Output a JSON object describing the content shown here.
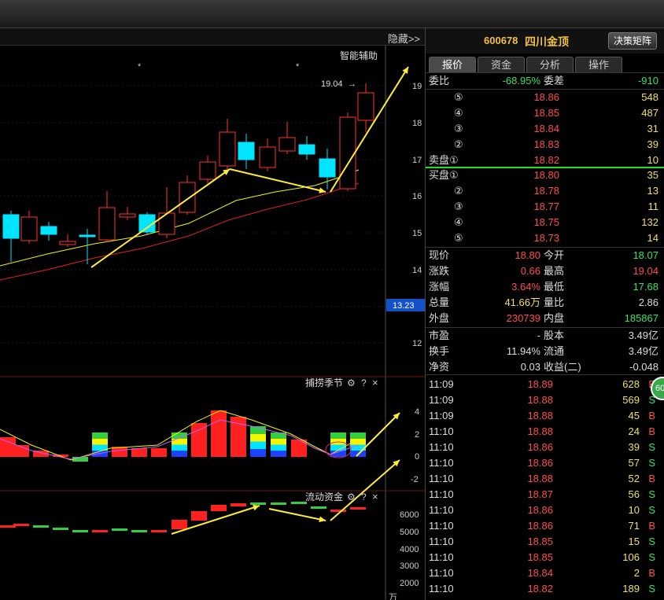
{
  "chart": {
    "hide_label": "隐藏>>",
    "assist_label": "智能辅助",
    "last_high_label": "19.04",
    "current_price_tag": "13.23",
    "price_axis": [
      "19",
      "18",
      "17",
      "16",
      "15",
      "14",
      "12"
    ],
    "indicator1": {
      "title": "捕捞季节",
      "axis": [
        "4",
        "2",
        "0",
        "-2"
      ]
    },
    "indicator2": {
      "title": "流动资金",
      "axis": [
        "6000",
        "5000",
        "4000",
        "3000",
        "2000"
      ],
      "unit": "万"
    },
    "gear_icon": "gear-icon",
    "help_label": "?",
    "close_label": "×",
    "star_label": "*"
  },
  "quote": {
    "code": "600678",
    "name": "四川金顶",
    "decision_button": "决策矩阵",
    "tabs": [
      "报价",
      "资金",
      "分析",
      "操作"
    ],
    "weibi": {
      "label": "委比",
      "value": "-68.95%",
      "label2": "委差",
      "value2": "-910"
    },
    "asks": [
      {
        "label": "⑤",
        "price": "18.86",
        "vol": "548"
      },
      {
        "label": "④",
        "price": "18.85",
        "vol": "487"
      },
      {
        "label": "③",
        "price": "18.84",
        "vol": "31"
      },
      {
        "label": "②",
        "price": "18.83",
        "vol": "39"
      },
      {
        "label": "卖盘①",
        "price": "18.82",
        "vol": "10"
      }
    ],
    "bids": [
      {
        "label": "买盘①",
        "price": "18.80",
        "vol": "35"
      },
      {
        "label": "②",
        "price": "18.78",
        "vol": "13"
      },
      {
        "label": "③",
        "price": "18.77",
        "vol": "11"
      },
      {
        "label": "④",
        "price": "18.75",
        "vol": "132"
      },
      {
        "label": "⑤",
        "price": "18.73",
        "vol": "14"
      }
    ],
    "stats": [
      {
        "l1": "现价",
        "v1": "18.80",
        "l2": "今开",
        "v2": "18.07"
      },
      {
        "l1": "涨跌",
        "v1": "0.66",
        "l2": "最高",
        "v2": "19.04"
      },
      {
        "l1": "涨幅",
        "v1": "3.64%",
        "l2": "最低",
        "v2": "17.68"
      },
      {
        "l1": "总量",
        "v1": "41.66万",
        "l2": "量比",
        "v2": "2.86"
      },
      {
        "l1": "外盘",
        "v1": "230739",
        "l2": "内盘",
        "v2": "185867"
      }
    ],
    "stats2": [
      {
        "l1": "市盈",
        "v1": "-",
        "l2": "股本",
        "v2": "3.49亿"
      },
      {
        "l1": "换手",
        "v1": "11.94%",
        "l2": "流通",
        "v2": "3.49亿"
      },
      {
        "l1": "净资",
        "v1": "0.03",
        "l2": "收益(二)",
        "v2": "-0.048"
      }
    ],
    "ticks": [
      {
        "time": "11:09",
        "price": "18.89",
        "vol": "628",
        "side": "B"
      },
      {
        "time": "11:09",
        "price": "18.88",
        "vol": "569",
        "side": "S"
      },
      {
        "time": "11:09",
        "price": "18.88",
        "vol": "45",
        "side": "B"
      },
      {
        "time": "11:10",
        "price": "18.88",
        "vol": "24",
        "side": "B"
      },
      {
        "time": "11:10",
        "price": "18.86",
        "vol": "39",
        "side": "S"
      },
      {
        "time": "11:10",
        "price": "18.86",
        "vol": "57",
        "side": "S"
      },
      {
        "time": "11:10",
        "price": "18.88",
        "vol": "52",
        "side": "B"
      },
      {
        "time": "11:10",
        "price": "18.87",
        "vol": "56",
        "side": "S"
      },
      {
        "time": "11:10",
        "price": "18.86",
        "vol": "10",
        "side": "S"
      },
      {
        "time": "11:10",
        "price": "18.86",
        "vol": "71",
        "side": "B"
      },
      {
        "time": "11:10",
        "price": "18.85",
        "vol": "15",
        "side": "S"
      },
      {
        "time": "11:10",
        "price": "18.85",
        "vol": "106",
        "side": "S"
      },
      {
        "time": "11:10",
        "price": "18.84",
        "vol": "2",
        "side": "B"
      },
      {
        "time": "11:10",
        "price": "18.82",
        "vol": "189",
        "side": "S"
      }
    ],
    "float_badge": "60"
  },
  "colors": {
    "up": "#ff3333",
    "down": "#00e5ff",
    "ma_yellow": "#f5f500",
    "ma_red": "#e02020",
    "arrow": "#ffee33"
  }
}
